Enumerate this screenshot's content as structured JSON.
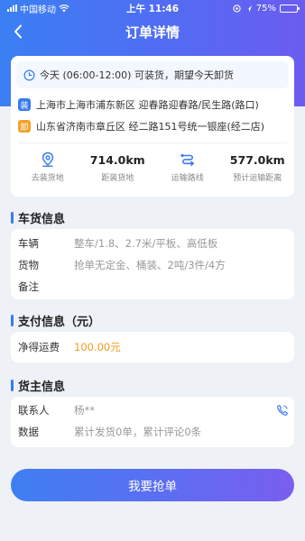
{
  "status_bar": {
    "carrier": "中国移动",
    "time": "上午 11:46",
    "battery": "75%",
    "battery_level": 0.75,
    "icons": [
      "signal-icon",
      "wifi-icon",
      "location-icon",
      "alarm-icon",
      "battery-icon"
    ]
  },
  "nav": {
    "title": "订单详情",
    "back_icon": "chevron-left-icon"
  },
  "order": {
    "time_window": "今天 (06:00-12:00) 可装货，期望今天卸货",
    "load_badge": "装",
    "load_address": "上海市上海市浦东新区 迎春路迎春路/民生路(路口)",
    "unload_badge": "卸",
    "unload_address": "山东省济南市章丘区 经二路151号统一银座(经二店)",
    "stats": [
      {
        "icon": "location-pin-icon",
        "value": "",
        "label": "去装货地"
      },
      {
        "icon": "",
        "value": "714.0km",
        "label": "距装货地"
      },
      {
        "icon": "route-icon",
        "value": "",
        "label": "运输路线"
      },
      {
        "icon": "",
        "value": "577.0km",
        "label": "预计运输距离"
      }
    ]
  },
  "cargo": {
    "title": "车货信息",
    "rows": [
      {
        "label": "车辆",
        "value": "整车/1.8、2.7米/平板、高低板"
      },
      {
        "label": "货物",
        "value": "抢单无定金、桶装、2吨/3件/4方"
      },
      {
        "label": "备注",
        "value": ""
      }
    ]
  },
  "payment": {
    "title": "支付信息（元）",
    "label": "净得运费",
    "value": "100.00元"
  },
  "shipper": {
    "title": "货主信息",
    "contact_label": "联系人",
    "contact_value": "杨**",
    "data_label": "数据",
    "data_value": "累计发货0单，累计评论0条"
  },
  "action": {
    "grab_label": "我要抢单"
  },
  "colors": {
    "accent": "#3a7bf0",
    "header_gradient_start": "#3b7ff3",
    "header_gradient_end": "#6b5cf0",
    "money": "#f39a1f",
    "load_badge": "#3a7bf0",
    "unload_badge": "#f3a22e"
  }
}
